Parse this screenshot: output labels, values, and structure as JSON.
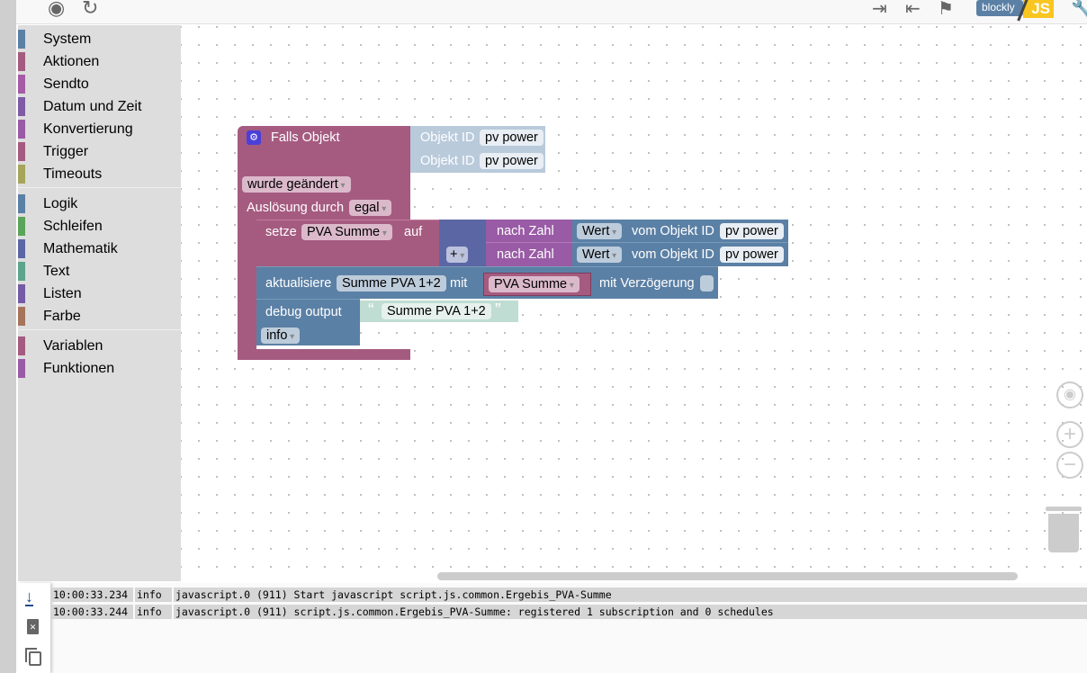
{
  "toolbar": {
    "left_icons": [
      "locate-icon",
      "refresh-icon"
    ],
    "right_icons": [
      "export-icon",
      "import-icon",
      "checkered-flag-icon",
      "settings-wrench-icon"
    ],
    "mode_blockly": "blockly",
    "mode_js": "JS"
  },
  "sidebar": {
    "groups": [
      [
        {
          "label": "System",
          "color": "#5b80a5"
        },
        {
          "label": "Aktionen",
          "color": "#a55b80"
        },
        {
          "label": "Sendto",
          "color": "#a55ba5"
        },
        {
          "label": "Datum und Zeit",
          "color": "#805ba5"
        },
        {
          "label": "Konvertierung",
          "color": "#995ba5"
        },
        {
          "label": "Trigger",
          "color": "#a55b80"
        },
        {
          "label": "Timeouts",
          "color": "#a5a55b"
        }
      ],
      [
        {
          "label": "Logik",
          "color": "#5b80a5"
        },
        {
          "label": "Schleifen",
          "color": "#5ba55b"
        },
        {
          "label": "Mathematik",
          "color": "#5b67a5"
        },
        {
          "label": "Text",
          "color": "#5ba58c"
        },
        {
          "label": "Listen",
          "color": "#745ba5"
        },
        {
          "label": "Farbe",
          "color": "#a5745b"
        }
      ],
      [
        {
          "label": "Variablen",
          "color": "#a55b80"
        },
        {
          "label": "Funktionen",
          "color": "#995ba5"
        }
      ]
    ]
  },
  "blocks": {
    "trigger": {
      "title": "Falls Objekt",
      "object_label": "Objekt ID",
      "objects": [
        "pv power",
        "pv power"
      ],
      "condition": "wurde geändert",
      "trigger_by_label": "Auslösung durch",
      "trigger_by": "egal"
    },
    "set": {
      "label": "setze",
      "variable": "PVA Summe",
      "to": "auf",
      "operator": "+",
      "to_number": "nach Zahl",
      "value": "Wert",
      "from_object": "vom Objekt ID",
      "objects": [
        "pv power",
        "pv power"
      ]
    },
    "update": {
      "label": "aktualisiere",
      "state": "Summe PVA 1+2",
      "with": "mit",
      "variable": "PVA Summe",
      "delay_label": "mit Verzögerung"
    },
    "debug": {
      "label": "debug output",
      "text": "Summe PVA 1+2",
      "level": "info",
      "quote_open": "“",
      "quote_close": "”"
    }
  },
  "colors": {
    "event": "#a55b80",
    "math": "#5b67a5",
    "convert": "#995ba5",
    "system": "#5b80a5",
    "object": "#b9cadb",
    "text": "#bfddd2"
  },
  "log": {
    "icons": [
      "scroll-down-icon",
      "delete-icon",
      "copy-icon"
    ],
    "rows": [
      {
        "time": "10:00:33.234",
        "level": "info",
        "message": "javascript.0 (911) Start javascript script.js.common.Ergebis_PVA-Summe"
      },
      {
        "time": "10:00:33.244",
        "level": "info",
        "message": "javascript.0 (911) script.js.common.Ergebis_PVA-Summe: registered 1 subscription and 0 schedules"
      }
    ]
  }
}
